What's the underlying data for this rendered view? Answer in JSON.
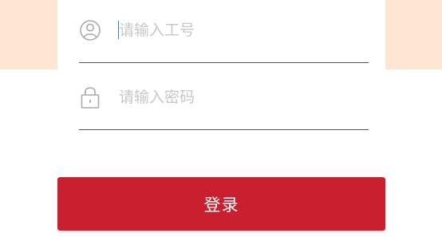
{
  "login": {
    "employee_id": {
      "icon": "user-circle-icon",
      "placeholder": "请输入工号",
      "value": ""
    },
    "password": {
      "icon": "lock-icon",
      "placeholder": "请输入密码",
      "value": ""
    },
    "submit_label": "登录"
  },
  "colors": {
    "header_band": "#fee6d2",
    "primary_button": "#c91f2f",
    "placeholder_text": "#c8c8c8",
    "underline": "#555555",
    "icon_stroke": "#aaaaaa"
  }
}
